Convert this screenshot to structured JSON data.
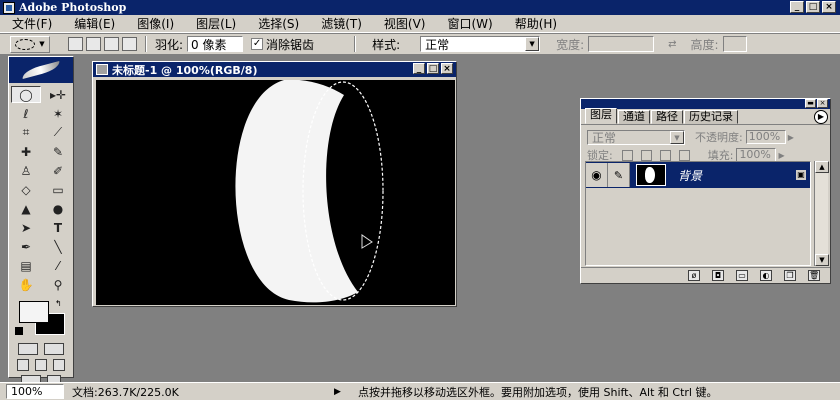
{
  "app": {
    "title": "Adobe Photoshop",
    "window_buttons": [
      "_",
      "□",
      "×"
    ]
  },
  "menu": [
    "文件(F)",
    "编辑(E)",
    "图像(I)",
    "图层(L)",
    "选择(S)",
    "滤镜(T)",
    "视图(V)",
    "窗口(W)",
    "帮助(H)"
  ],
  "options": {
    "feather_label": "羽化:",
    "feather_value": "0 像素",
    "antialias_check": "✓",
    "antialias_label": "消除锯齿",
    "style_label": "样式:",
    "style_value": "正常",
    "width_label": "宽度:",
    "height_label": "高度:"
  },
  "document": {
    "title": "未标题-1 @ 100%(RGB/8)",
    "buttons": [
      "_",
      "□",
      "×"
    ]
  },
  "layers_panel": {
    "tabs": [
      "图层",
      "通道",
      "路径",
      "历史记录"
    ],
    "blend_mode": "正常",
    "opacity_label": "不透明度:",
    "opacity_value": "100%",
    "lock_label": "锁定:",
    "fill_label": "填充:",
    "fill_value": "100%",
    "layer_name": "背景"
  },
  "status": {
    "zoom": "100%",
    "doc_size": "文档:263.7K/225.0K",
    "arrow": "▶",
    "hint": "点按并拖移以移动选区外框。要用附加选项，使用 Shift、Alt 和 Ctrl 键。"
  },
  "colors": {
    "titlebar": "#0a246a",
    "chrome": "#d4d0c8",
    "workspace": "#808080",
    "foreground_color": "#f4f4f4",
    "background_color": "#000000"
  }
}
